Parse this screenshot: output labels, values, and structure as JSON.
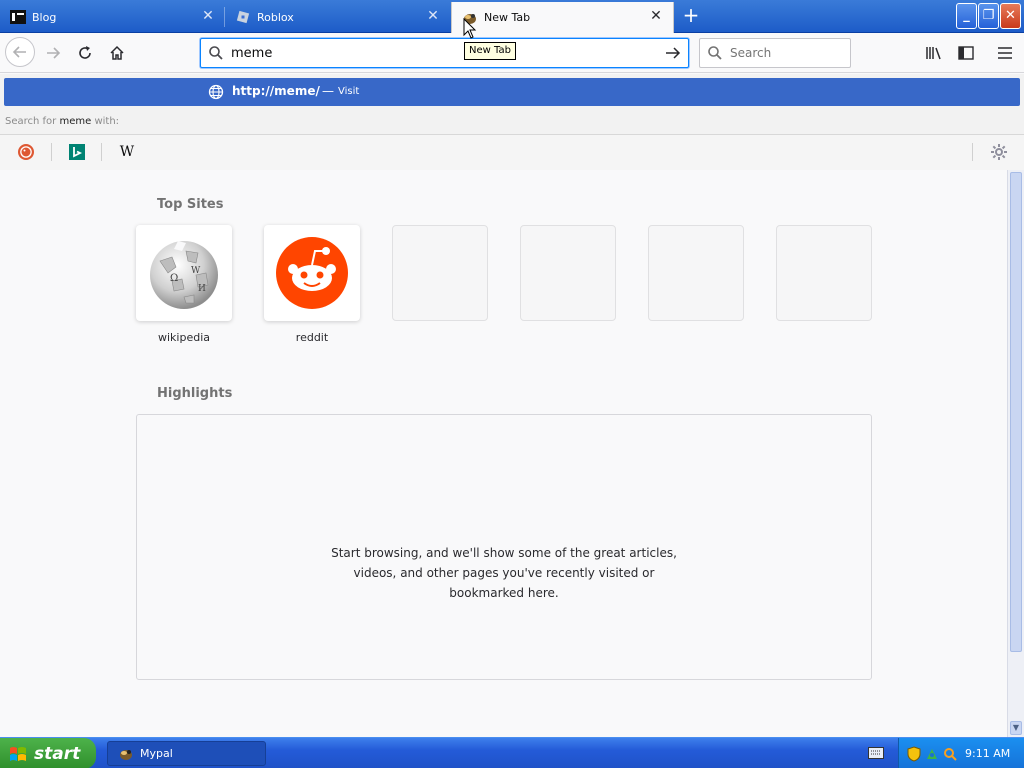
{
  "tabs": [
    {
      "title": "Blog",
      "active": false
    },
    {
      "title": "Roblox",
      "active": false
    },
    {
      "title": "New Tab",
      "active": true
    }
  ],
  "tooltip": "New Tab",
  "urlbar": {
    "value": "meme"
  },
  "searchbar": {
    "placeholder": "Search"
  },
  "popup": {
    "url_prefix": "http://",
    "url_host": "meme",
    "url_suffix": "/",
    "dash": "—",
    "action": "Visit",
    "search_for_prefix": "Search for ",
    "search_term": "meme",
    "search_for_suffix": " with:",
    "engines": [
      "duckduckgo",
      "bing",
      "wikipedia"
    ]
  },
  "top_sites": {
    "title": "Top Sites",
    "tiles": [
      {
        "label": "wikipedia",
        "icon": "wikipedia-globe-icon"
      },
      {
        "label": "reddit",
        "icon": "reddit-alien-icon"
      },
      {
        "label": "",
        "icon": ""
      },
      {
        "label": "",
        "icon": ""
      },
      {
        "label": "",
        "icon": ""
      },
      {
        "label": "",
        "icon": ""
      }
    ]
  },
  "highlights": {
    "title": "Highlights",
    "empty_message": "Start browsing, and we'll show some of the great articles, videos, and other pages you've recently visited or bookmarked here."
  },
  "taskbar": {
    "start_label": "start",
    "task_label": "Mypal",
    "clock": "9:11 AM"
  },
  "colors": {
    "accent": "#0a84ff",
    "popup_highlight": "#3868c8",
    "reddit": "#ff4500",
    "xp_blue": "#245bd8",
    "start_green": "#2f8f2c"
  }
}
